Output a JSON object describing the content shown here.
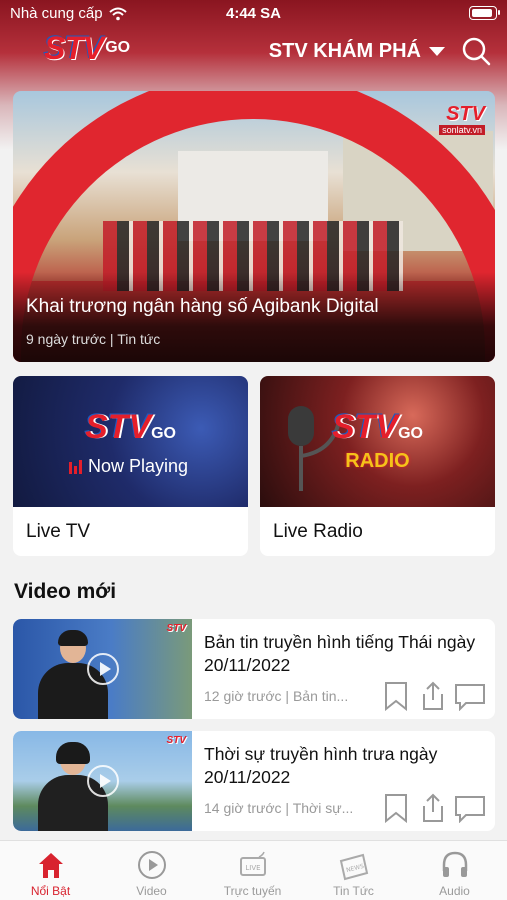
{
  "status_bar": {
    "carrier": "Nhà cung cấp",
    "time": "4:44 SA",
    "battery_level": 0.9
  },
  "header": {
    "logo_text": "STV",
    "logo_suffix": "GO",
    "menu_title": "STV KHÁM PHÁ",
    "search_icon": "search-icon",
    "colors": {
      "brand_red": "#e41f2b",
      "header_bg": "#8a1520"
    }
  },
  "hero": {
    "title": "Khai trương ngân hàng số Agibank Digital",
    "meta": "9 ngày trước | Tin tức",
    "watermark": "STV",
    "watermark_sub": "sonlatv.vn"
  },
  "live": [
    {
      "label": "Live TV",
      "overlay": "Now Playing",
      "logo": "STV",
      "logo_suffix": "GO"
    },
    {
      "label": "Live Radio",
      "overlay": "RADIO",
      "logo": "STV",
      "logo_suffix": "GO"
    }
  ],
  "section": {
    "title": "Video mới"
  },
  "videos": [
    {
      "title": "Bản tin truyền hình tiếng Thái ngày 20/11/2022",
      "meta": "12 giờ trước | Bản tin...",
      "thumb_logo": "STV"
    },
    {
      "title": "Thời sự truyền hình trưa ngày 20/11/2022",
      "meta": "14 giờ trước | Thời sự...",
      "thumb_logo": "STV"
    }
  ],
  "tabs": [
    {
      "label": "Nổi Bật",
      "icon": "home-icon",
      "active": true
    },
    {
      "label": "Video",
      "icon": "play-circle-icon",
      "active": false
    },
    {
      "label": "Trực tuyến",
      "icon": "live-tv-icon",
      "active": false
    },
    {
      "label": "Tin Tức",
      "icon": "news-icon",
      "active": false
    },
    {
      "label": "Audio",
      "icon": "headphones-icon",
      "active": false
    }
  ]
}
